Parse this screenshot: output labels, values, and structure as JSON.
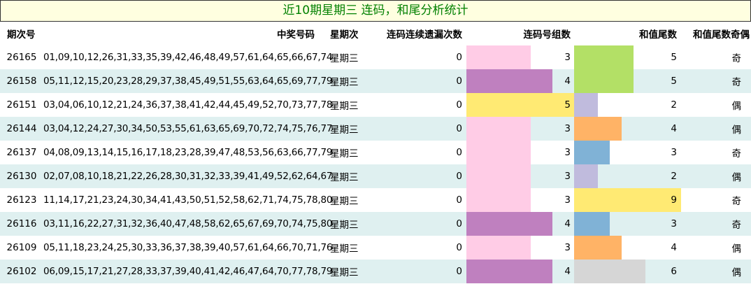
{
  "title": "近10期星期三 连码，和尾分析统计",
  "headers": {
    "issue": "期次号",
    "numbers": "中奖号码",
    "weekday": "星期次",
    "miss": "连码连续遗漏次数",
    "groups": "连码号组数",
    "sum_tail": "和值尾数",
    "parity": "和值尾数奇偶"
  },
  "group_colors": {
    "3": "#ffcce6",
    "4": "#bf80bf",
    "5": "#ffea73"
  },
  "sum_colors": {
    "2": "#c0bbdd",
    "3": "#80b2d6",
    "4": "#ffb366",
    "5": "#b3e066",
    "6": "#d6d6d6",
    "9": "#ffea73"
  },
  "rows": [
    {
      "issue": "26165",
      "numbers": "01,09,10,12,26,31,33,35,39,42,46,48,49,57,61,64,65,66,67,74",
      "weekday": "星期三",
      "miss": "0",
      "groups": "3",
      "sum_tail": "5",
      "parity": "奇"
    },
    {
      "issue": "26158",
      "numbers": "05,11,12,15,20,23,28,29,37,38,45,49,51,55,63,64,65,69,77,79",
      "weekday": "星期三",
      "miss": "0",
      "groups": "4",
      "sum_tail": "5",
      "parity": "奇"
    },
    {
      "issue": "26151",
      "numbers": "03,04,06,10,12,21,24,36,37,38,41,42,44,45,49,52,70,73,77,78",
      "weekday": "星期三",
      "miss": "0",
      "groups": "5",
      "sum_tail": "2",
      "parity": "偶"
    },
    {
      "issue": "26144",
      "numbers": "03,04,12,24,27,30,34,50,53,55,61,63,65,69,70,72,74,75,76,77",
      "weekday": "星期三",
      "miss": "0",
      "groups": "3",
      "sum_tail": "4",
      "parity": "偶"
    },
    {
      "issue": "26137",
      "numbers": "04,08,09,13,14,15,16,17,18,23,28,39,47,48,53,56,63,66,77,79",
      "weekday": "星期三",
      "miss": "0",
      "groups": "3",
      "sum_tail": "3",
      "parity": "奇"
    },
    {
      "issue": "26130",
      "numbers": "02,07,08,10,18,21,22,26,28,30,31,32,33,39,41,49,52,62,64,67",
      "weekday": "星期三",
      "miss": "0",
      "groups": "3",
      "sum_tail": "2",
      "parity": "偶"
    },
    {
      "issue": "26123",
      "numbers": "11,14,17,21,23,24,30,34,41,43,50,51,52,58,62,71,74,75,78,80",
      "weekday": "星期三",
      "miss": "0",
      "groups": "3",
      "sum_tail": "9",
      "parity": "奇"
    },
    {
      "issue": "26116",
      "numbers": "03,11,16,22,27,31,32,36,40,47,48,58,62,65,67,69,70,74,75,80",
      "weekday": "星期三",
      "miss": "0",
      "groups": "4",
      "sum_tail": "3",
      "parity": "奇"
    },
    {
      "issue": "26109",
      "numbers": "05,11,18,23,24,25,30,33,36,37,38,39,40,57,61,64,66,70,71,76",
      "weekday": "星期三",
      "miss": "0",
      "groups": "3",
      "sum_tail": "4",
      "parity": "偶"
    },
    {
      "issue": "26102",
      "numbers": "06,09,15,17,21,27,28,33,37,39,40,41,42,46,47,64,70,77,78,79",
      "weekday": "星期三",
      "miss": "0",
      "groups": "4",
      "sum_tail": "6",
      "parity": "偶"
    }
  ]
}
